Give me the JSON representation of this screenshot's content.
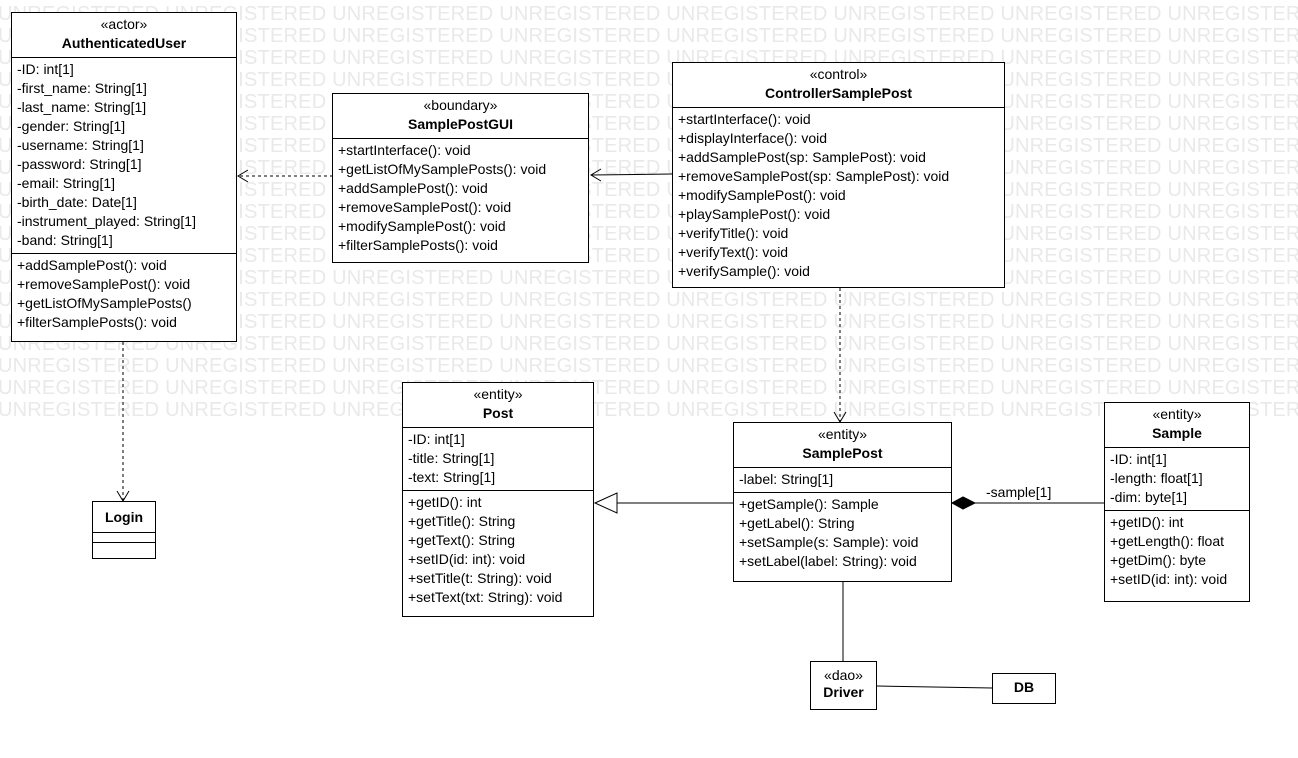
{
  "watermark_text": "UNREGISTERED",
  "classes": {
    "authenticated_user": {
      "stereotype": "«actor»",
      "name": "AuthenticatedUser",
      "attributes": [
        "-ID: int[1]",
        "-first_name: String[1]",
        "-last_name: String[1]",
        "-gender: String[1]",
        "-username: String[1]",
        "-password: String[1]",
        "-email: String[1]",
        "-birth_date: Date[1]",
        "-instrument_played: String[1]",
        "-band: String[1]"
      ],
      "operations": [
        "+addSamplePost(): void",
        "+removeSamplePost(): void",
        "+getListOfMySamplePosts()",
        "+filterSamplePosts(): void"
      ]
    },
    "sample_post_gui": {
      "stereotype": "«boundary»",
      "name": "SamplePostGUI",
      "operations": [
        "+startInterface(): void",
        "+getListOfMySamplePosts(): void",
        "+addSamplePost(): void",
        "+removeSamplePost(): void",
        "+modifySamplePost(): void",
        "+filterSamplePosts(): void"
      ]
    },
    "controller_sample_post": {
      "stereotype": "«control»",
      "name": "ControllerSamplePost",
      "operations": [
        "+startInterface(): void",
        "+displayInterface(): void",
        "+addSamplePost(sp: SamplePost): void",
        "+removeSamplePost(sp: SamplePost): void",
        "+modifySamplePost(): void",
        "+playSamplePost(): void",
        "+verifyTitle(): void",
        "+verifyText(): void",
        "+verifySample(): void"
      ]
    },
    "post": {
      "stereotype": "«entity»",
      "name": "Post",
      "attributes": [
        "-ID: int[1]",
        "-title: String[1]",
        "-text: String[1]"
      ],
      "operations": [
        "+getID(): int",
        "+getTitle(): String",
        "+getText(): String",
        "+setID(id: int): void",
        "+setTitle(t: String): void",
        "+setText(txt: String): void"
      ]
    },
    "sample_post": {
      "stereotype": "«entity»",
      "name": "SamplePost",
      "attributes": [
        "-label: String[1]"
      ],
      "operations": [
        "+getSample(): Sample",
        "+getLabel(): String",
        "+setSample(s: Sample): void",
        "+setLabel(label: String): void"
      ]
    },
    "sample": {
      "stereotype": "«entity»",
      "name": "Sample",
      "attributes": [
        "-ID: int[1]",
        "-length: float[1]",
        "-dim: byte[1]"
      ],
      "operations": [
        "+getID(): int",
        "+getLength(): float",
        "+getDim(): byte",
        "+setID(id: int): void"
      ]
    },
    "login": {
      "name": "Login"
    },
    "driver": {
      "stereotype": "«dao»",
      "name": "Driver"
    },
    "db": {
      "name": "DB"
    }
  },
  "relations": {
    "samplepost_sample_label": "-sample[1]"
  }
}
